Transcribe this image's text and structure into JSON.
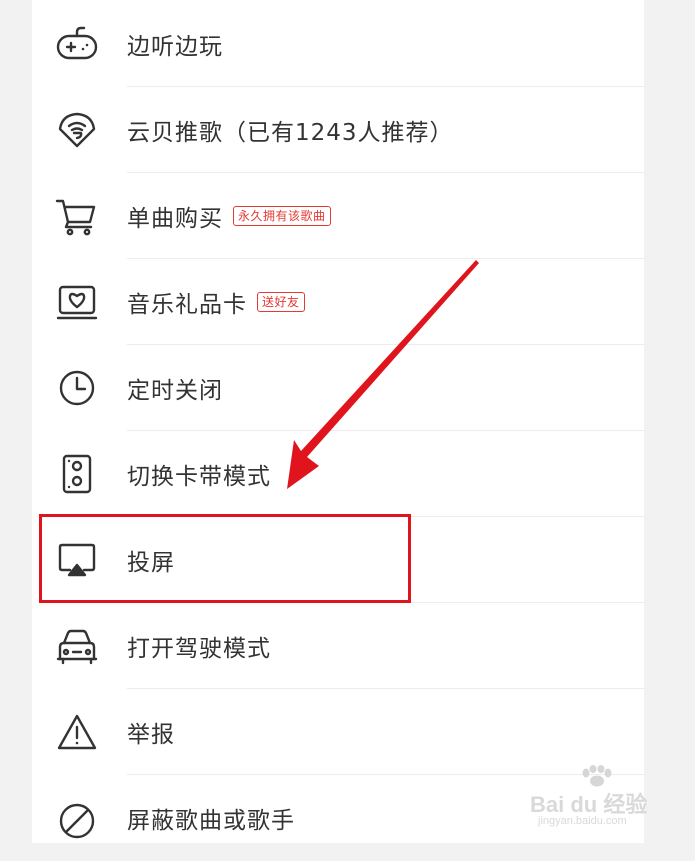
{
  "menu": {
    "items": [
      {
        "label": "边听边玩",
        "icon": "gamepad-icon"
      },
      {
        "label": "云贝推歌（已有1243人推荐）",
        "icon": "cloud-shell-icon"
      },
      {
        "label": "单曲购买",
        "icon": "shopping-cart-icon",
        "badge": "永久拥有该歌曲"
      },
      {
        "label": "音乐礼品卡",
        "icon": "gift-card-icon",
        "badge": "送好友"
      },
      {
        "label": "定时关闭",
        "icon": "clock-icon"
      },
      {
        "label": "切换卡带模式",
        "icon": "cassette-icon"
      },
      {
        "label": "投屏",
        "icon": "cast-screen-icon"
      },
      {
        "label": "打开驾驶模式",
        "icon": "car-icon"
      },
      {
        "label": "举报",
        "icon": "warning-icon"
      },
      {
        "label": "屏蔽歌曲或歌手",
        "icon": "block-icon"
      }
    ]
  },
  "annotation": {
    "highlight_color": "#e0141c",
    "highlighted_item": "投屏"
  },
  "watermark": {
    "brand": "Bai du 经验",
    "url": "jingyan.baidu.com"
  },
  "colors": {
    "text": "#333333",
    "badge": "#e53935",
    "divider": "#ececec",
    "background": "#f2f2f2"
  }
}
